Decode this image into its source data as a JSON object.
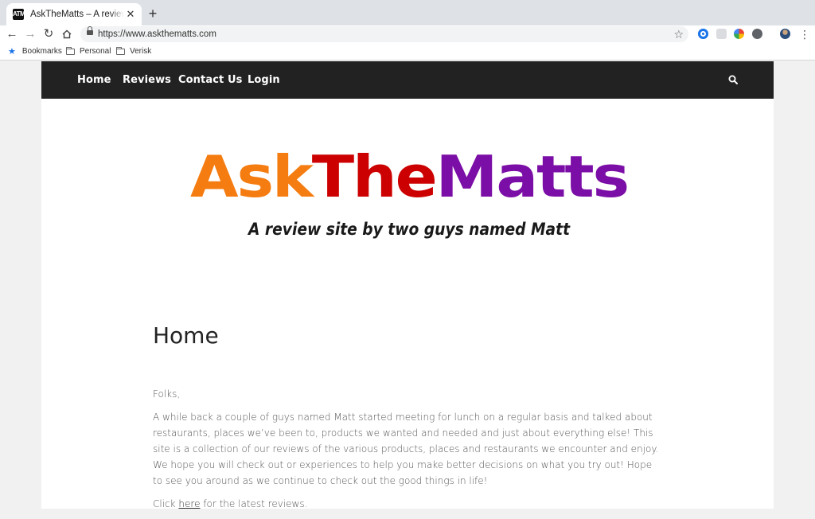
{
  "browser": {
    "tab_title": "AskTheMatts – A review site by two guys named Matt",
    "favicon_text": "ATM",
    "new_tab_icon": "plus-icon",
    "url": "https://www.askthematts.com",
    "bookmarks": [
      {
        "label": "Bookmarks",
        "icon": "star-icon"
      },
      {
        "label": "Personal",
        "icon": "folder-icon"
      },
      {
        "label": "Verisk",
        "icon": "folder-icon"
      }
    ]
  },
  "site": {
    "nav": [
      "Home",
      "Reviews",
      "Contact Us",
      "Login"
    ],
    "logo": {
      "part1": "Ask",
      "part2": "The",
      "part3": "Matts",
      "tagline": "A review site by two guys named Matt",
      "colors": {
        "part1": "#f57c10",
        "part2": "#cc0000",
        "part3": "#7b0ea6",
        "tagline": "#1a1a1a"
      }
    },
    "nav_bg": "#222222",
    "page_title": "Home",
    "greeting": "Folks,",
    "intro": "A while back a couple of guys named Matt started meeting for lunch on a regular basis and talked about restaurants, places we’ve been to, products we wanted and needed and just about everything else! This site is a collection of our reviews of the various products, places and restaurants we encounter and enjoy. We hope you will check out or experiences to help you make better decisions on what you try out! Hope to see you around as we continue to check out the good things in life!",
    "cta_prefix": "Click ",
    "cta_link": "here",
    "cta_suffix": " for the latest reviews."
  }
}
